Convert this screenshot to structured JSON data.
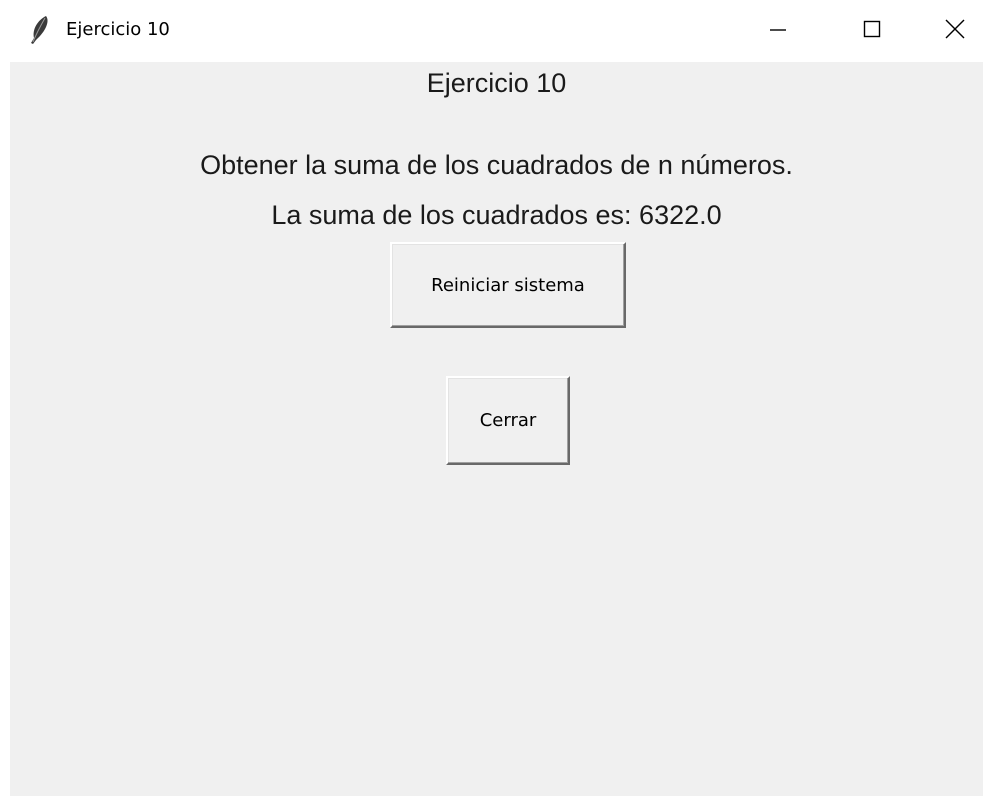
{
  "window": {
    "title": "Ejercicio 10",
    "icon": "feather-icon",
    "controls": {
      "minimize": "minimize-icon",
      "maximize": "maximize-icon",
      "close": "close-icon"
    }
  },
  "main": {
    "heading": "Ejercicio 10",
    "description": "Obtener la suma de los cuadrados de n números.",
    "result": "La suma de los cuadrados es: 6322.0",
    "reset_button_label": "Reiniciar sistema",
    "close_button_label": "Cerrar"
  },
  "colors": {
    "client_background": "#f0f0f0",
    "titlebar_background": "#ffffff"
  }
}
